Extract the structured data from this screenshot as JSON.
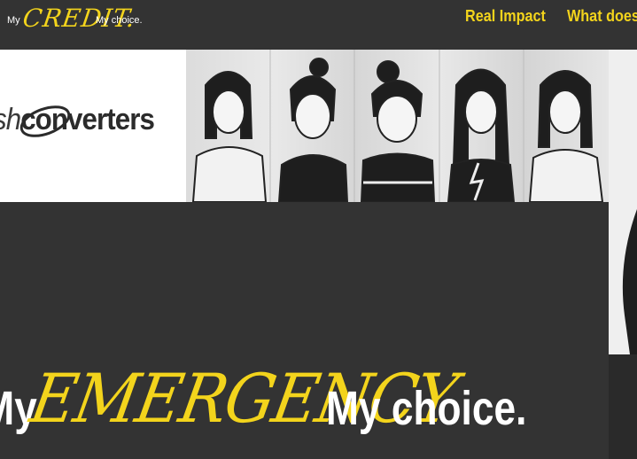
{
  "header": {
    "brand": {
      "my": "My",
      "credit": "CREDIT.",
      "choice": "My choice."
    },
    "nav": [
      {
        "label": "Real Impact"
      },
      {
        "label": "What does it"
      }
    ]
  },
  "banner": {
    "logo_prefix": "sh",
    "logo_main": "converters"
  },
  "hero": {
    "my": "My",
    "emphasis": "EMERGENCY",
    "choice": "My choice."
  },
  "colors": {
    "accent": "#f3d41c",
    "background": "#333333",
    "banner": "#ffffff"
  }
}
